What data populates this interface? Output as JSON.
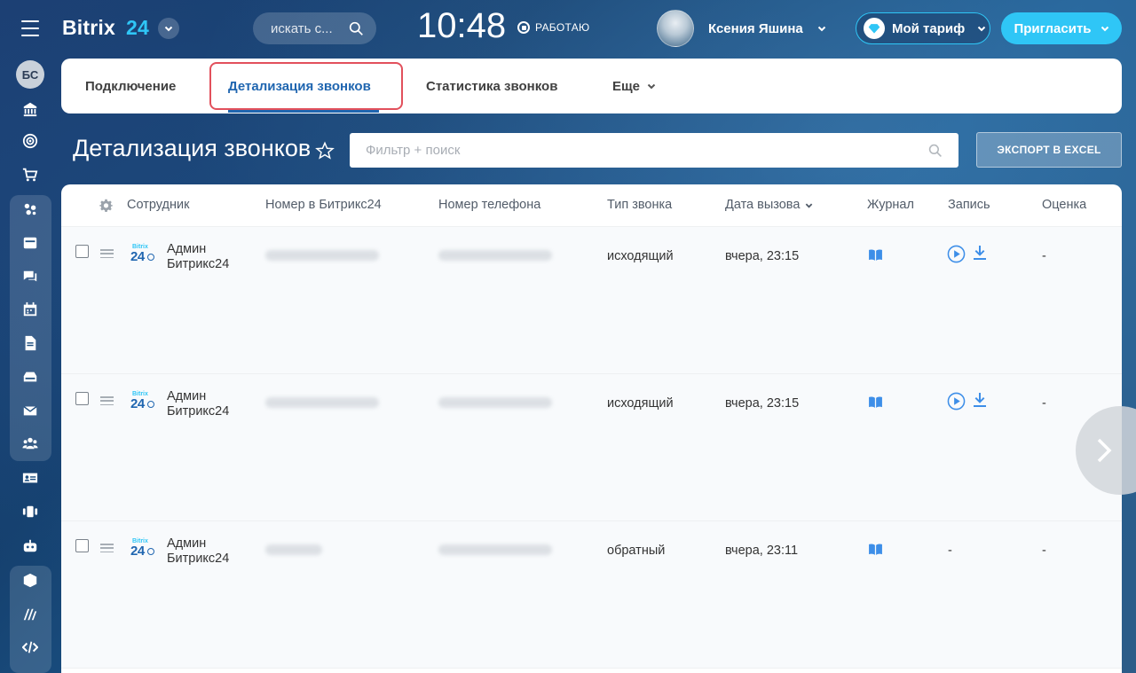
{
  "header": {
    "logo_text": "Bitrix",
    "logo_num": "24",
    "search_placeholder": "искать с...",
    "clock": "10:48",
    "work_status": "РАБОТАЮ",
    "user_name": "Ксения Яшина",
    "tariff_label": "Мой тариф",
    "invite_label": "Пригласить"
  },
  "sidebar": {
    "avatar_initials": "БС",
    "items": [
      "home-icon",
      "goal-icon",
      "cart-icon",
      "crm-icon",
      "feed-icon",
      "chat-icon",
      "calendar-icon",
      "document-icon",
      "drive-icon",
      "mail-icon",
      "group-icon",
      "contact-center-icon",
      "telephony-icon",
      "robot-icon",
      "market-icon",
      "sites-icon",
      "developer-icon"
    ]
  },
  "tabs": [
    {
      "label": "Подключение"
    },
    {
      "label": "Детализация звонков"
    },
    {
      "label": "Статистика звонков"
    },
    {
      "label": "Еще"
    }
  ],
  "page": {
    "title": "Детализация звонков",
    "filter_placeholder": "Фильтр + поиск",
    "export_label": "ЭКСПОРТ В EXCEL"
  },
  "grid": {
    "columns": [
      "Сотрудник",
      "Номер в Битрикс24",
      "Номер телефона",
      "Тип звонка",
      "Дата вызова",
      "Журнал",
      "Запись",
      "Оценка"
    ],
    "rows": [
      {
        "employee_line1": "Админ",
        "employee_line2": "Битрикс24",
        "logo_small": "Bitrix",
        "logo_big": "24",
        "call_type": "исходящий",
        "date": "вчера, 23:15",
        "has_record": true,
        "record_dash": "",
        "rating": "-"
      },
      {
        "employee_line1": "Админ",
        "employee_line2": "Битрикс24",
        "logo_small": "Bitrix",
        "logo_big": "24",
        "call_type": "исходящий",
        "date": "вчера, 23:15",
        "has_record": true,
        "record_dash": "",
        "rating": "-"
      },
      {
        "employee_line1": "Админ",
        "employee_line2": "Битрикс24",
        "logo_small": "Bitrix",
        "logo_big": "24",
        "call_type": "обратный",
        "date": "вчера, 23:11",
        "has_record": false,
        "record_dash": "-",
        "rating": "-"
      }
    ]
  },
  "colors": {
    "accent": "#2fc6f6",
    "link_blue": "#2066b0",
    "icon_blue": "#3d8ee8",
    "highlight_red": "#e2505c"
  }
}
